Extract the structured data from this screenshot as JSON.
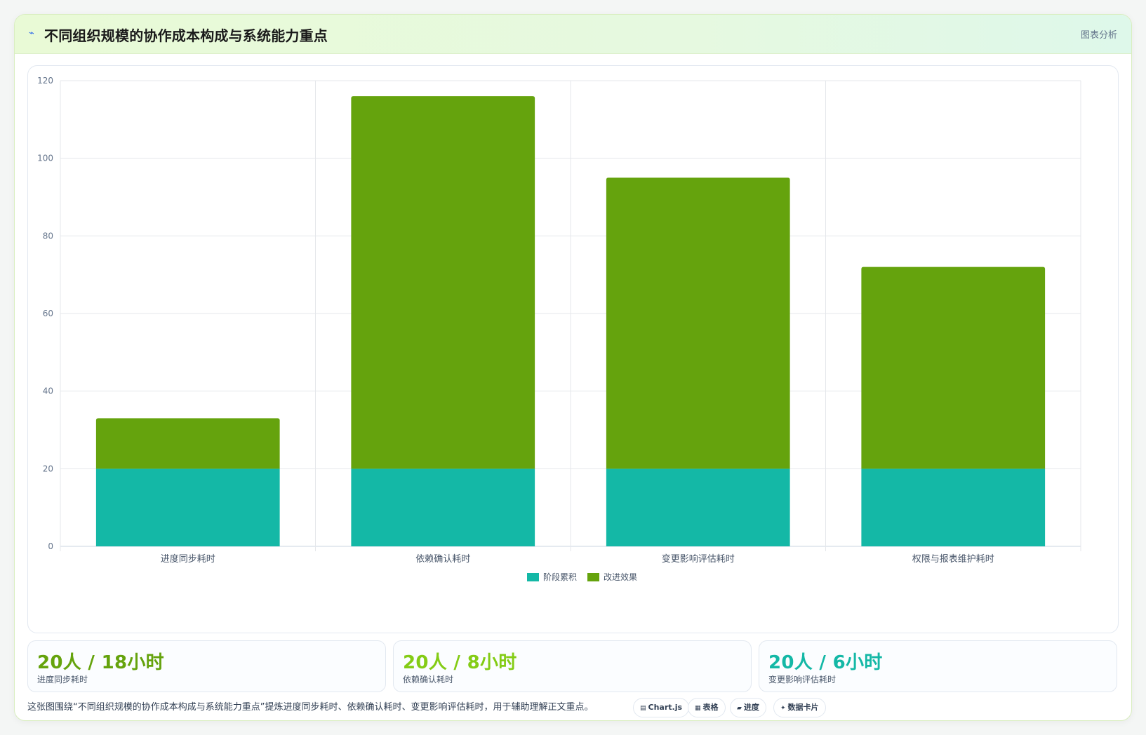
{
  "header": {
    "icon": "trend-icon",
    "title": "不同组织规模的协作成本构成与系统能力重点",
    "badge": "图表分析"
  },
  "chart_data": {
    "type": "bar",
    "stacked": true,
    "categories": [
      "进度同步耗时",
      "依赖确认耗时",
      "变更影响评估耗时",
      "权限与报表维护耗时"
    ],
    "series": [
      {
        "name": "阶段累积",
        "color": "#14b8a6",
        "values": [
          20,
          20,
          20,
          20
        ]
      },
      {
        "name": "改进效果",
        "color": "#65a30d",
        "values": [
          13,
          96,
          75,
          52
        ]
      }
    ],
    "ylim": [
      0,
      120
    ],
    "yticks": [
      0,
      20,
      40,
      60,
      80,
      100,
      120
    ],
    "grid": true,
    "legend": "bottom"
  },
  "kpis": [
    {
      "value": "20人 / 18小时",
      "label": "进度同步耗时",
      "color": "#65a30d"
    },
    {
      "value": "20人 / 8小时",
      "label": "依赖确认耗时",
      "color": "#84cc16"
    },
    {
      "value": "20人 / 6小时",
      "label": "变更影响评估耗时",
      "color": "#14b8a6"
    }
  ],
  "summary": "这张图围绕“不同组织规模的协作成本构成与系统能力重点”提炼进度同步耗时、依赖确认耗时、变更影响评估耗时，用于辅助理解正文重点。",
  "tags": [
    {
      "label": "Chart.js",
      "icon": "chart-icon"
    },
    {
      "label": "表格",
      "icon": "table-icon"
    },
    {
      "label": "进度",
      "icon": "progress-icon"
    },
    {
      "label": "数据卡片",
      "icon": "sparkle-icon"
    }
  ]
}
